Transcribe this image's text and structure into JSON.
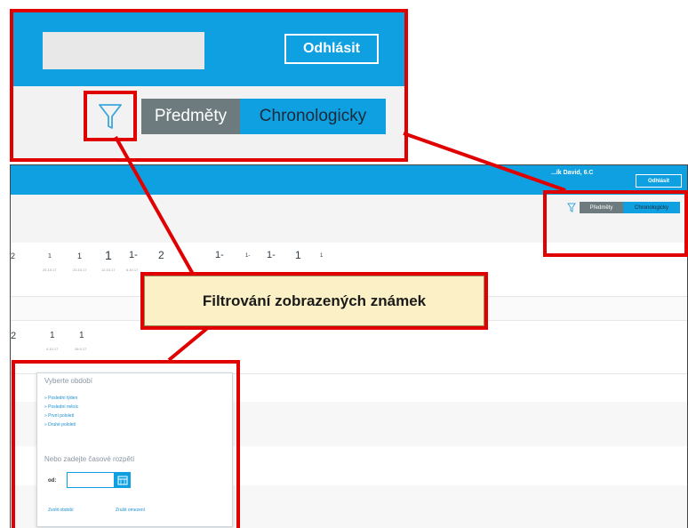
{
  "zoom": {
    "logout_label": "Odhlásit",
    "tabs": [
      {
        "label": "Předměty",
        "active": true
      },
      {
        "label": "Chronologicky",
        "active": false
      }
    ],
    "filter_icon": "funnel-icon"
  },
  "header": {
    "user_name": "...ík David, 6.C",
    "logout_label": "Odhlásit"
  },
  "toolbar": {
    "filter_icon": "funnel-icon",
    "tabs": [
      {
        "label": "Předměty",
        "active": true
      },
      {
        "label": "Chronologicky",
        "active": false
      }
    ]
  },
  "grades": {
    "row1": [
      {
        "value": "2",
        "date": ""
      },
      {
        "value": "1",
        "date": "25.10.17"
      },
      {
        "value": "1",
        "date": "23.10.17"
      },
      {
        "value": "1",
        "date": "12.10.17"
      },
      {
        "value": "1-",
        "date": "6.10.17"
      },
      {
        "value": "2",
        "date": ""
      },
      {
        "value": "1-",
        "date": ""
      },
      {
        "value": "1-",
        "date": ""
      },
      {
        "value": "1-",
        "date": ""
      },
      {
        "value": "1",
        "date": ""
      },
      {
        "value": "1",
        "date": ""
      }
    ],
    "row2": [
      {
        "value": "2",
        "date": ""
      },
      {
        "value": "1",
        "date": "4.10.17"
      },
      {
        "value": "1",
        "date": "26.9.17"
      }
    ]
  },
  "callout": {
    "text": "Filtrování zobrazených známek"
  },
  "popup": {
    "title": "Vyberte období",
    "options": [
      "» Poslední týden",
      "» Poslední měsíc",
      "» První pololetí",
      "» Druhé pololetí"
    ],
    "range_title": "Nebo zadejte časové rozpětí",
    "from_label": "od:",
    "from_value": "",
    "choose_label": "Zvolit období",
    "cancel_label": "Zrušit omezení"
  },
  "colors": {
    "accent": "#0ea0e0",
    "highlight": "#e00000",
    "callout_bg": "#fcf1c6"
  }
}
